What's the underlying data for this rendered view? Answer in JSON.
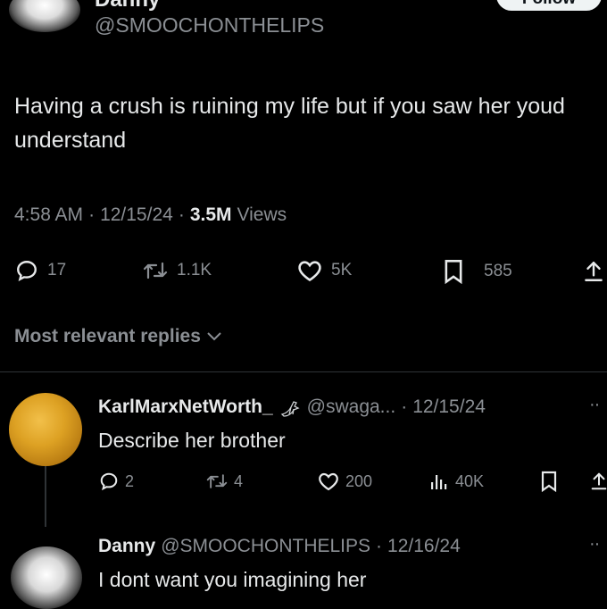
{
  "main_tweet": {
    "author_name": "Danny",
    "handle": "@SMOOCHONTHELIPS",
    "follow_label": "Follow",
    "text": "Having a crush is ruining my life but if you saw her youd understand",
    "time": "4:58 AM",
    "date": "12/15/24",
    "views_count": "3.5M",
    "views_label": "Views",
    "replies": "17",
    "retweets": "1.1K",
    "likes": "5K",
    "bookmarks": "585"
  },
  "replies_filter": {
    "label": "Most relevant replies"
  },
  "replies": [
    {
      "name": "KarlMarxNetWorth_",
      "handle": "@swaga...",
      "date": "12/15/24",
      "text": "Describe her brother",
      "replies": "2",
      "retweets": "4",
      "likes": "200",
      "views": "40K"
    },
    {
      "name": "Danny",
      "handle": "@SMOOCHONTHELIPS",
      "date": "12/16/24",
      "text": "I dont want you imagining her"
    }
  ],
  "colors": {
    "background": "#000000",
    "text": "#e7e9ea",
    "muted": "#8b8f94",
    "divider": "#2f3336"
  }
}
